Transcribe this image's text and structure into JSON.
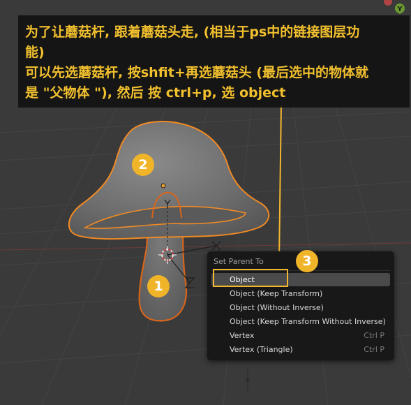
{
  "annotation": {
    "line1": "为了让蘑菇杆, 跟着蘑菇头走, (相当于ps中的链接图层功",
    "line2": "能)",
    "line3": "可以先选蘑菇杆, 按shfit+再选蘑菇头 (最后选中的物体就",
    "line4": "是 \"父物体 \"), 然后 按 ctrl+p, 选 object"
  },
  "gizmo": {
    "axis_label": "Y"
  },
  "badges": [
    "1",
    "2",
    "3"
  ],
  "menu": {
    "title": "Set Parent To",
    "items": [
      {
        "label": "Object",
        "shortcut": "",
        "active": true
      },
      {
        "label": "Object (Keep Transform)",
        "shortcut": ""
      },
      {
        "label": "Object (Without Inverse)",
        "shortcut": ""
      },
      {
        "label": "Object (Keep Transform Without Inverse)",
        "shortcut": ""
      },
      {
        "label": "Vertex",
        "shortcut": "Ctrl P"
      },
      {
        "label": "Vertex (Triangle)",
        "shortcut": "Ctrl P"
      }
    ]
  },
  "colors": {
    "viewport_bg": "#3a3a3a",
    "annotation_text": "#f2c02e",
    "selection_outline": "#f08a24",
    "badge": "#f0b428",
    "menu_bg": "#181818"
  }
}
